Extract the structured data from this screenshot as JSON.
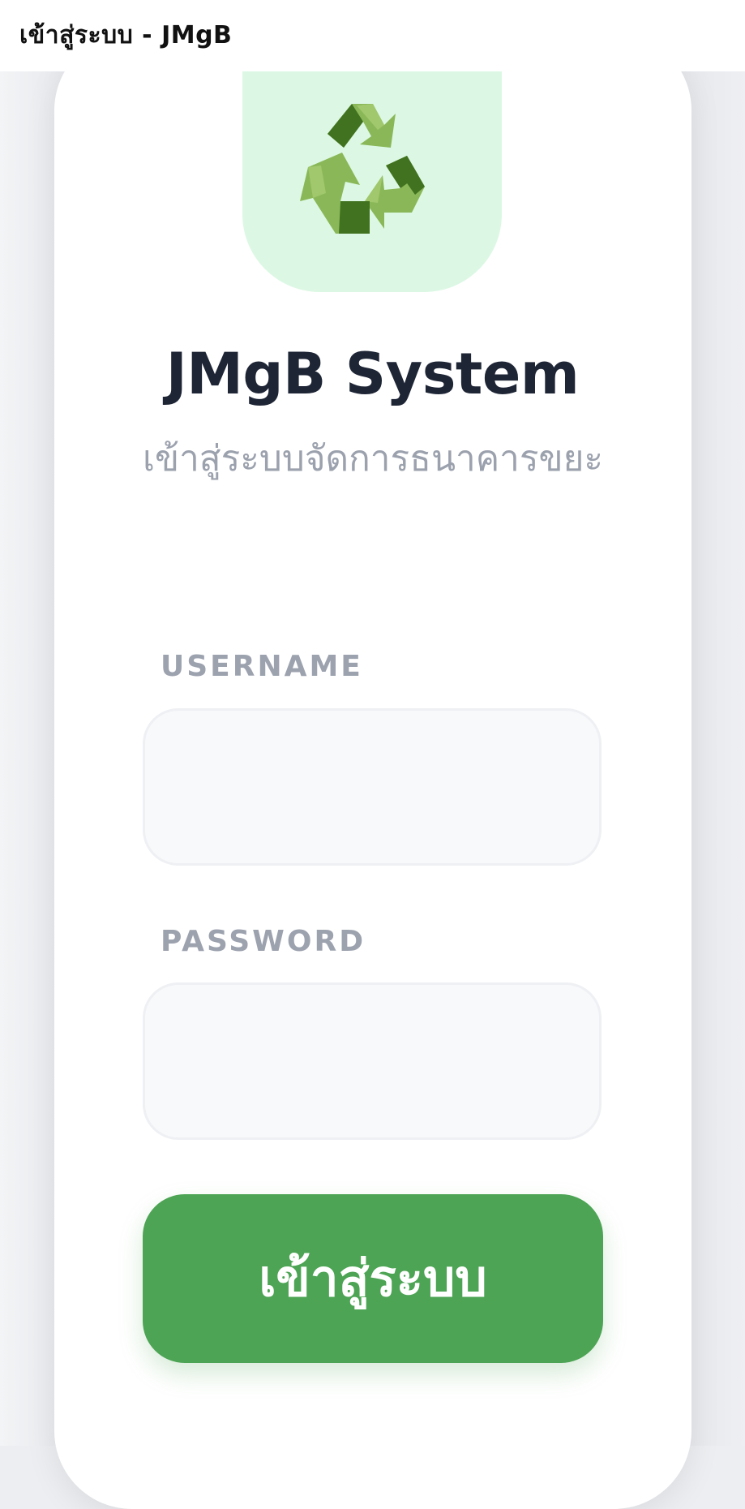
{
  "window": {
    "title": "เข้าสู่ระบบ - JMgB"
  },
  "logo": {
    "icon": "recycle-icon",
    "background": "#dcf8e4",
    "colors": {
      "dark_green": "#41721f",
      "light_green": "#8ab858"
    }
  },
  "header": {
    "app_name": "JMgB System",
    "subtitle": "เข้าสู่ระบบจัดการธนาคารขยะ"
  },
  "form": {
    "username_label": "USERNAME",
    "username_value": "",
    "password_label": "PASSWORD",
    "password_value": "",
    "submit_label": "เข้าสู่ระบบ"
  },
  "colors": {
    "primary_button": "#4ca454",
    "heading": "#1e2535",
    "muted_text": "#9ba1ad"
  }
}
